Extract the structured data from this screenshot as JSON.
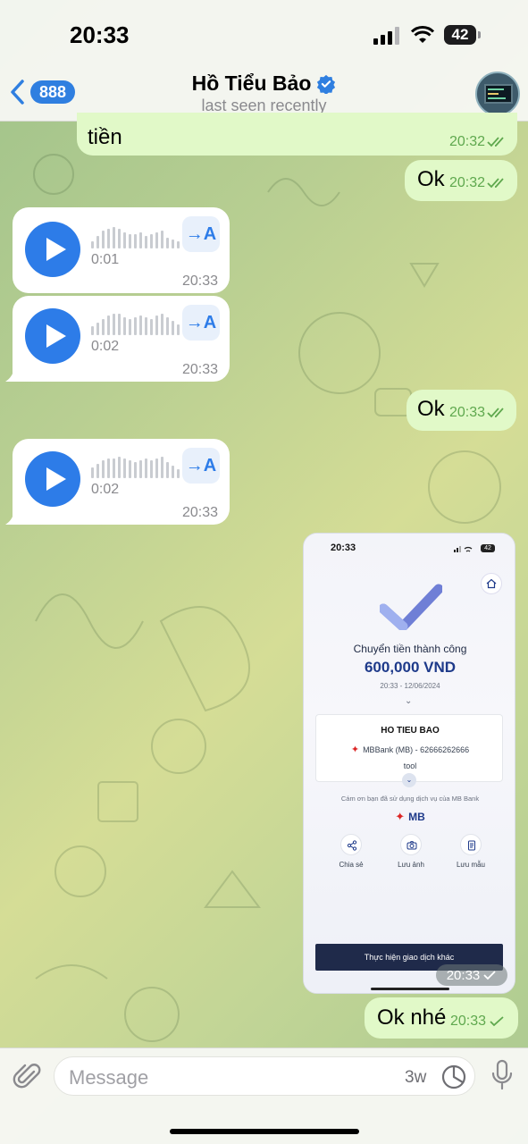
{
  "status_bar": {
    "time": "20:33",
    "battery": "42"
  },
  "header": {
    "back_count": "888",
    "contact_name": "Hồ Tiểu Bảo",
    "status": "last seen recently"
  },
  "messages": [
    {
      "dir": "out",
      "text": "tiền",
      "time": "20:32",
      "read": true
    },
    {
      "dir": "out",
      "text": "Ok",
      "time": "20:32",
      "read": true
    },
    {
      "dir": "in",
      "type": "voice",
      "duration": "0:01",
      "time": "20:33",
      "transcribe": "→A"
    },
    {
      "dir": "in",
      "type": "voice",
      "duration": "0:02",
      "time": "20:33",
      "transcribe": "→A"
    },
    {
      "dir": "out",
      "text": "Ok",
      "time": "20:33",
      "read": true
    },
    {
      "dir": "in",
      "type": "voice",
      "duration": "0:02",
      "time": "20:33",
      "transcribe": "→A"
    },
    {
      "dir": "out",
      "type": "image",
      "time": "20:33",
      "screenshot": {
        "time": "20:33",
        "battery": "42",
        "status": "Chuyển tiền thành công",
        "amount": "600,000 VND",
        "datetime": "20:33 - 12/06/2024",
        "recipient": "HO TIEU BAO",
        "bank_account": "MBBank (MB) - 62666262666",
        "note": "tool",
        "thanks": "Cám ơn bạn đã sử dụng dịch vụ của MB Bank",
        "logo": "MB",
        "actions": [
          "Chia sẻ",
          "Lưu ảnh",
          "Lưu mẫu"
        ],
        "button": "Thực hiện giao dịch khác"
      }
    },
    {
      "dir": "out",
      "text": "Ok nhé",
      "time": "20:33",
      "read": false
    }
  ],
  "input": {
    "placeholder": "Message",
    "badge": "3w"
  },
  "colors": {
    "accent": "#2d7ce8",
    "outgoing": "#e1f9c8",
    "incoming": "#ffffff",
    "check": "#5fa84e"
  }
}
